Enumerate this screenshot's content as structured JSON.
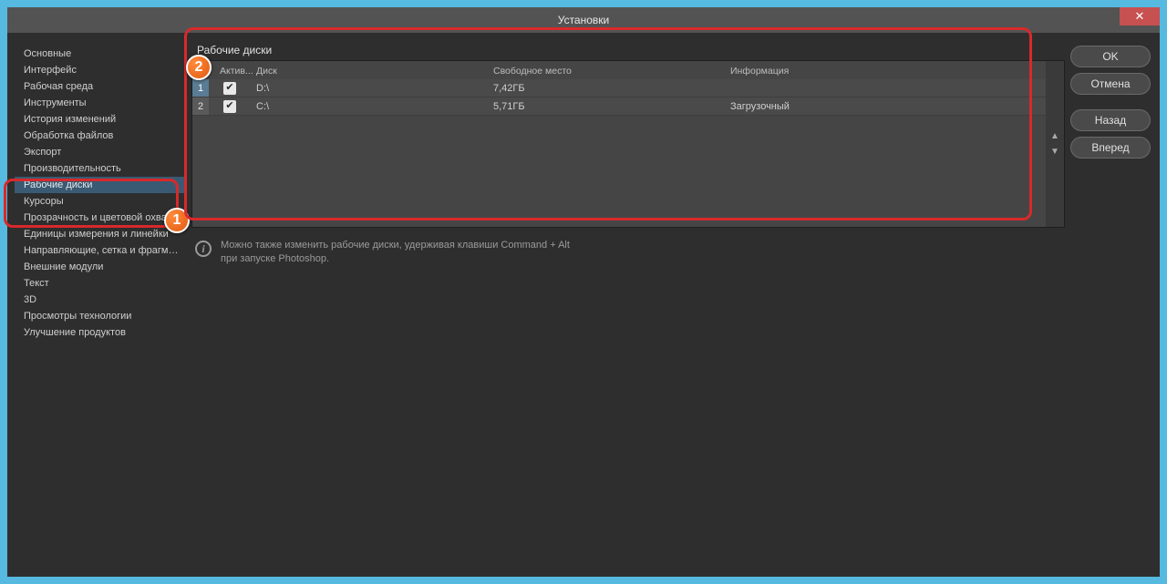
{
  "window": {
    "title": "Установки"
  },
  "close_symbol": "✕",
  "sidebar": {
    "items": [
      {
        "label": "Основные",
        "selected": false
      },
      {
        "label": "Интерфейс",
        "selected": false
      },
      {
        "label": "Рабочая среда",
        "selected": false
      },
      {
        "label": "Инструменты",
        "selected": false
      },
      {
        "label": "История изменений",
        "selected": false
      },
      {
        "label": "Обработка файлов",
        "selected": false
      },
      {
        "label": "Экспорт",
        "selected": false
      },
      {
        "label": "Производительность",
        "selected": false
      },
      {
        "label": "Рабочие диски",
        "selected": true
      },
      {
        "label": "Курсоры",
        "selected": false
      },
      {
        "label": "Прозрачность и цветовой охват",
        "selected": false
      },
      {
        "label": "Единицы измерения и линейки",
        "selected": false
      },
      {
        "label": "Направляющие, сетка и фрагменты",
        "selected": false
      },
      {
        "label": "Внешние модули",
        "selected": false
      },
      {
        "label": "Текст",
        "selected": false
      },
      {
        "label": "3D",
        "selected": false
      },
      {
        "label": "Просмотры технологии",
        "selected": false
      },
      {
        "label": "Улучшение продуктов",
        "selected": false
      }
    ]
  },
  "panel": {
    "title": "Рабочие диски",
    "columns": {
      "active": "Актив...",
      "drive": "Диск",
      "free": "Свободное место",
      "info": "Информация"
    },
    "rows": [
      {
        "num": "1",
        "active": true,
        "drive": "D:\\",
        "free": "7,42ГБ",
        "info": ""
      },
      {
        "num": "2",
        "active": true,
        "drive": "C:\\",
        "free": "5,71ГБ",
        "info": "Загрузочный"
      }
    ],
    "check_glyph": "✔",
    "arrow_up": "▲",
    "arrow_down": "▼"
  },
  "hint": {
    "line1": "Можно также изменить рабочие диски, удерживая клавиши Command + Alt",
    "line2": "при запуске Photoshop."
  },
  "buttons": {
    "ok": "OK",
    "cancel": "Отмена",
    "prev": "Назад",
    "next": "Вперед"
  },
  "callouts": {
    "one": "1",
    "two": "2"
  }
}
